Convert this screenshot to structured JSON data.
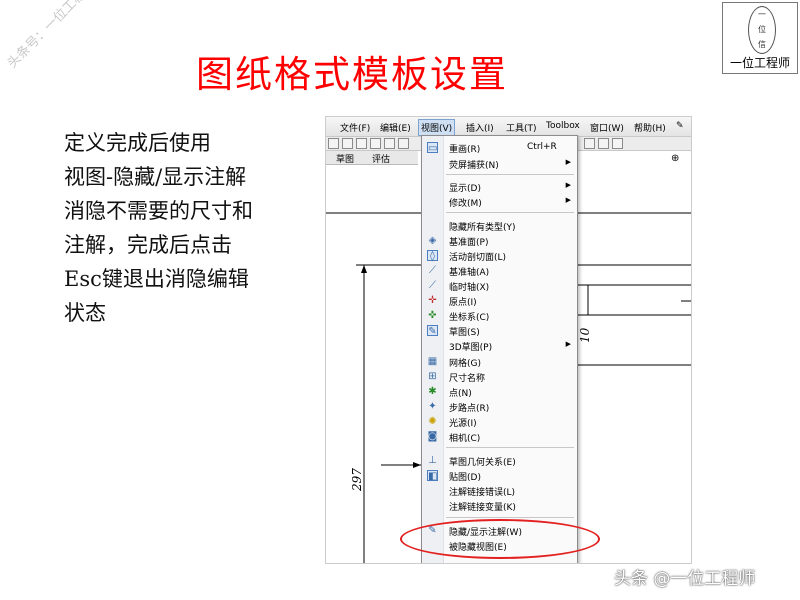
{
  "slide": {
    "title": "图纸格式模板设置",
    "watermark_top": "头条号：一位工程师",
    "watermark_bottom": "头条 @一位工程师",
    "logo": {
      "text": "一位工程师",
      "circle_top": "一",
      "circle_mid": "位",
      "circle_bottom": "信"
    },
    "body_lines": [
      "定义完成后使用",
      "视图-隐藏/显示注解",
      "消隐不需要的尺寸和",
      "注解，完成后点击",
      "Esc键退出消隐编辑",
      "状态"
    ]
  },
  "app": {
    "menubar": [
      "文件(F)",
      "编辑(E)",
      "视图(V)",
      "插入(I)",
      "工具(T)",
      "Toolbox",
      "窗口(W)",
      "帮助(H)"
    ],
    "active_menu": "视图(V)",
    "tabs": [
      "草图",
      "评估"
    ],
    "dimensions": {
      "vertical": "297",
      "small": "10"
    },
    "view_menu": {
      "items": [
        {
          "label": "重画(R)",
          "shortcut": "Ctrl+R",
          "icon": "redraw-icon",
          "submenu": false
        },
        {
          "label": "荧屏捕获(N)",
          "shortcut": "",
          "icon": "",
          "submenu": true
        },
        {
          "sep": true
        },
        {
          "label": "显示(D)",
          "shortcut": "",
          "icon": "",
          "submenu": true
        },
        {
          "label": "修改(M)",
          "shortcut": "",
          "icon": "",
          "submenu": true
        },
        {
          "sep": true
        },
        {
          "label": "隐藏所有类型(Y)",
          "shortcut": "",
          "icon": "",
          "submenu": false
        },
        {
          "label": "基准面(P)",
          "shortcut": "",
          "icon": "plane-icon",
          "submenu": false
        },
        {
          "label": "活动剖切面(L)",
          "shortcut": "",
          "icon": "section-plane-icon",
          "submenu": false
        },
        {
          "label": "基准轴(A)",
          "shortcut": "",
          "icon": "axis-icon",
          "submenu": false
        },
        {
          "label": "临时轴(X)",
          "shortcut": "",
          "icon": "temp-axis-icon",
          "submenu": false
        },
        {
          "label": "原点(I)",
          "shortcut": "",
          "icon": "origin-icon",
          "submenu": false
        },
        {
          "label": "坐标系(C)",
          "shortcut": "",
          "icon": "coordinate-system-icon",
          "submenu": false
        },
        {
          "label": "草图(S)",
          "shortcut": "",
          "icon": "sketch-icon",
          "submenu": false
        },
        {
          "label": "3D草图(P)",
          "shortcut": "",
          "icon": "",
          "submenu": true
        },
        {
          "label": "网格(G)",
          "shortcut": "",
          "icon": "grid-icon",
          "submenu": false
        },
        {
          "label": "尺寸名称",
          "shortcut": "",
          "icon": "dimension-name-icon",
          "submenu": false
        },
        {
          "label": "点(N)",
          "shortcut": "",
          "icon": "point-icon",
          "submenu": false
        },
        {
          "label": "步路点(R)",
          "shortcut": "",
          "icon": "route-point-icon",
          "submenu": false
        },
        {
          "label": "光源(I)",
          "shortcut": "",
          "icon": "light-icon",
          "submenu": false
        },
        {
          "label": "相机(C)",
          "shortcut": "",
          "icon": "camera-icon",
          "submenu": false
        },
        {
          "sep": true
        },
        {
          "label": "草图几何关系(E)",
          "shortcut": "",
          "icon": "sketch-relations-icon",
          "submenu": false
        },
        {
          "label": "贴图(D)",
          "shortcut": "",
          "icon": "decal-icon",
          "submenu": false
        },
        {
          "label": "注解链接错误(L)",
          "shortcut": "",
          "icon": "",
          "submenu": false
        },
        {
          "label": "注解链接变量(K)",
          "shortcut": "",
          "icon": "",
          "submenu": false
        },
        {
          "sep": true
        },
        {
          "label": "隐藏/显示注解(W)",
          "shortcut": "",
          "icon": "hide-show-annotation-icon",
          "submenu": false
        },
        {
          "label": "被隐藏视图(E)",
          "shortcut": "",
          "icon": "",
          "submenu": false
        }
      ]
    }
  },
  "colors": {
    "title_red": "#ff0000",
    "highlight_ellipse": "#e32020"
  }
}
